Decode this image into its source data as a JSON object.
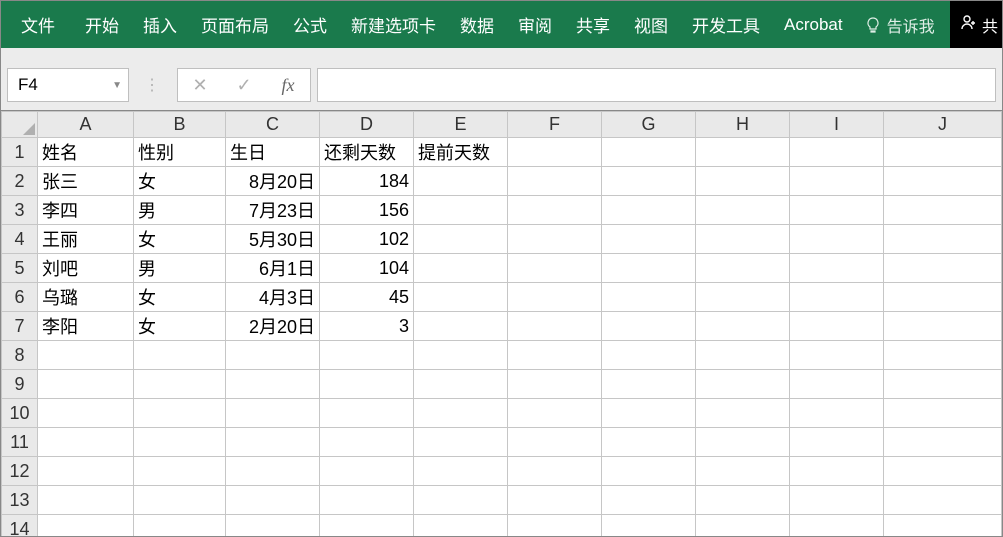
{
  "ribbon": {
    "tabs": [
      "文件",
      "开始",
      "插入",
      "页面布局",
      "公式",
      "新建选项卡",
      "数据",
      "审阅",
      "共享",
      "视图",
      "开发工具",
      "Acrobat"
    ],
    "tellme": "告诉我",
    "share": "共"
  },
  "formula_bar": {
    "namebox": "F4",
    "cancel": "✕",
    "confirm": "✓",
    "fx": "fx",
    "formula": ""
  },
  "columns": [
    "A",
    "B",
    "C",
    "D",
    "E",
    "F",
    "G",
    "H",
    "I",
    "J"
  ],
  "headers": {
    "c0": "姓名",
    "c1": "性别",
    "c2": "生日",
    "c3": "还剩天数",
    "c4": "提前天数"
  },
  "rows": [
    {
      "c0": "张三",
      "c1": "女",
      "c2": "8月20日",
      "c3": "184"
    },
    {
      "c0": "李四",
      "c1": "男",
      "c2": "7月23日",
      "c3": "156"
    },
    {
      "c0": "王丽",
      "c1": "女",
      "c2": "5月30日",
      "c3": "102"
    },
    {
      "c0": "刘吧",
      "c1": "男",
      "c2": "6月1日",
      "c3": "104"
    },
    {
      "c0": "乌璐",
      "c1": "女",
      "c2": "4月3日",
      "c3": "45"
    },
    {
      "c0": "李阳",
      "c1": "女",
      "c2": "2月20日",
      "c3": "3"
    }
  ],
  "row_numbers": [
    "1",
    "2",
    "3",
    "4",
    "5",
    "6",
    "7",
    "8",
    "9",
    "10",
    "11",
    "12",
    "13",
    "14"
  ]
}
